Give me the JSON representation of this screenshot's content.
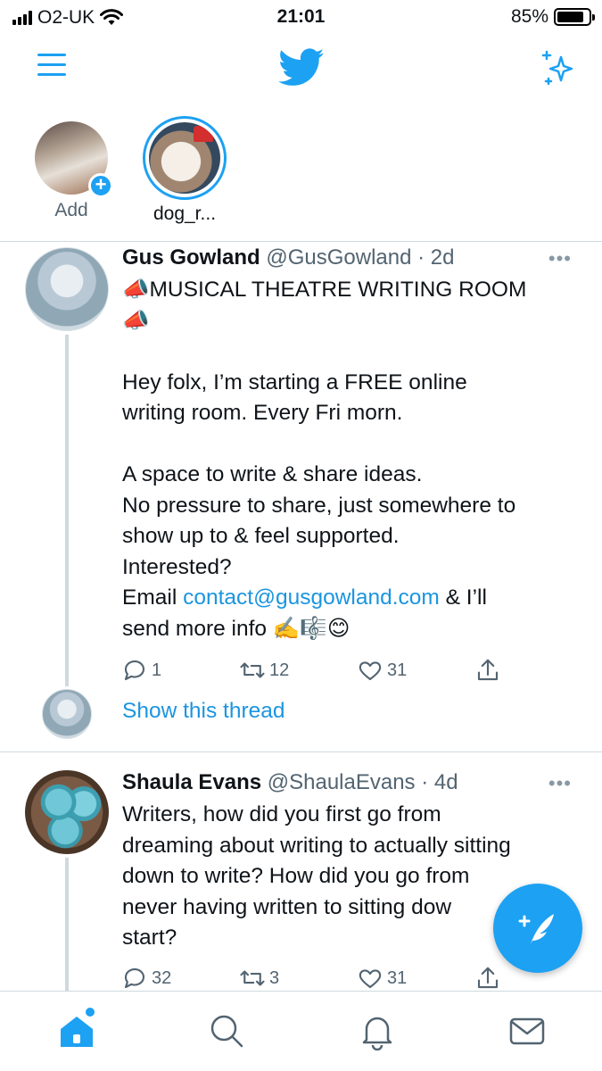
{
  "status_bar": {
    "carrier": "O2-UK",
    "time": "21:01",
    "battery": "85%",
    "battery_level": 0.85
  },
  "header": {
    "logo": "twitter-bird-icon",
    "left_icon": "menu-icon",
    "right_icon": "sparkle-icon"
  },
  "fleets": [
    {
      "label": "Add",
      "badge": "+"
    },
    {
      "label": "dog_r..."
    }
  ],
  "tweets": [
    {
      "name": "Gus Gowland",
      "handle": "@GusGowland",
      "time": "· 2d",
      "lines": [
        "📣MUSICAL THEATRE WRITING ROOM",
        "📣",
        "",
        "Hey folx, I’m starting a FREE online",
        "writing room. Every Fri morn.",
        "",
        "A space to write & share ideas.",
        "No pressure to share, just somewhere to",
        "show up to & feel supported.",
        "Interested?"
      ],
      "email_prefix": "Email ",
      "email_link": "contact@gusgowland.com",
      "email_suffix": " & I’ll",
      "last_line": "send more info ✍️🎼😊",
      "replies": "1",
      "retweets": "12",
      "likes": "31",
      "show_thread": "Show this thread"
    },
    {
      "name": "Shaula Evans",
      "handle": "@ShaulaEvans",
      "time": "· 4d",
      "lines": [
        "Writers, how did you first go from",
        "dreaming about writing to actually sitting",
        "down to write? How did you go from",
        "never having written to sitting dow",
        "start?"
      ],
      "replies": "32",
      "retweets": "3",
      "likes": "31"
    }
  ],
  "more_label": "•••",
  "colors": {
    "accent": "#1da1f2",
    "link": "#1b95e0",
    "muted": "#536471"
  },
  "tab_bar": {
    "items": [
      "home-icon",
      "search-icon",
      "bell-icon",
      "mail-icon"
    ]
  }
}
